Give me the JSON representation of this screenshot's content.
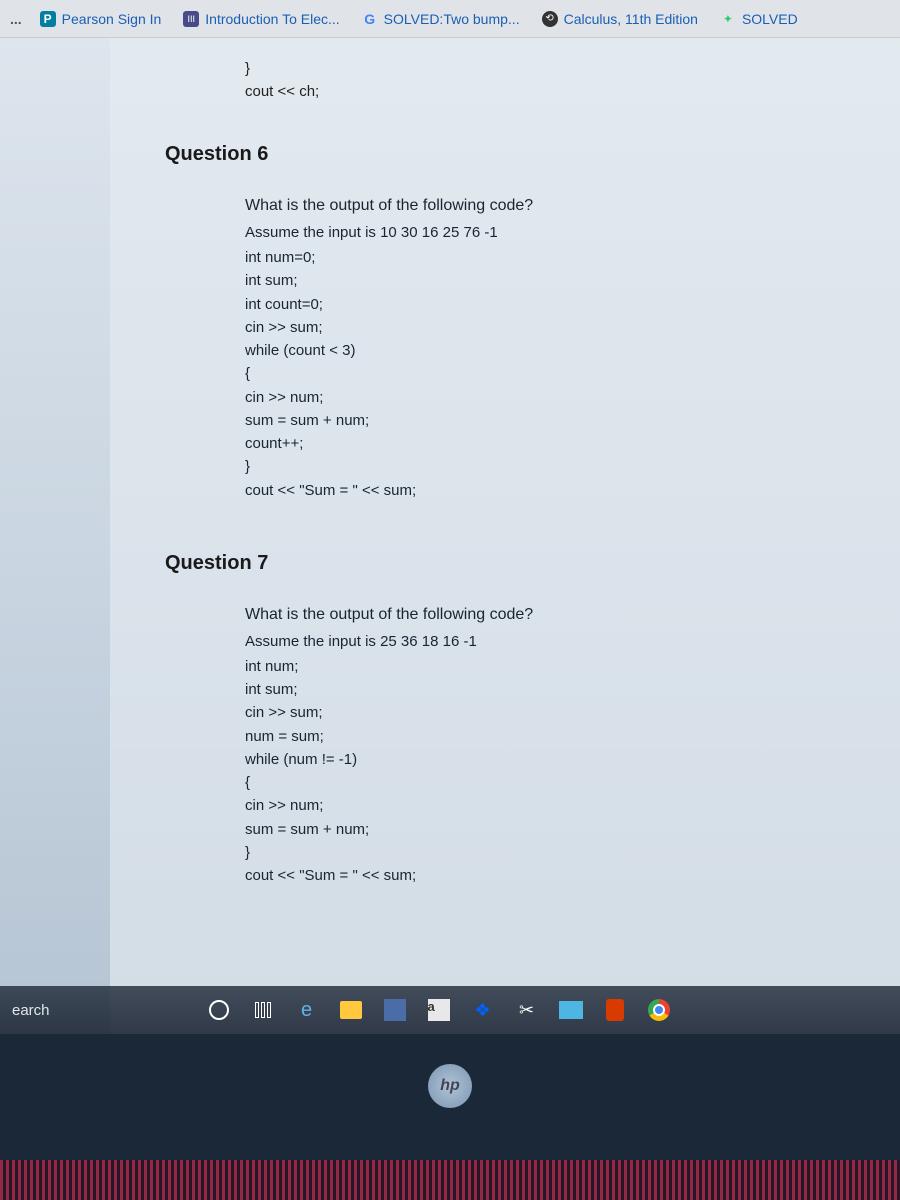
{
  "tabs": {
    "overflow": "...",
    "items": [
      {
        "icon": "P",
        "label": "Pearson Sign In"
      },
      {
        "icon": "III",
        "label": "Introduction To Elec..."
      },
      {
        "icon": "G",
        "label": "SOLVED:Two bump..."
      },
      {
        "icon": "⟲",
        "label": "Calculus, 11th Edition"
      },
      {
        "icon": "✦",
        "label": "SOLVED"
      }
    ]
  },
  "top_snippet": {
    "line1": "}",
    "line2": "cout << ch;"
  },
  "question6": {
    "title": "Question 6",
    "prompt": "What is the output of the following code?",
    "assume": "Assume the input is 10 30 16 25 76 -1",
    "code": [
      "int num=0;",
      "int sum;",
      "int count=0;",
      "cin >> sum;",
      "while (count < 3)",
      "{",
      "cin >> num;",
      "sum = sum + num;",
      "count++;",
      "}",
      "cout << \"Sum = \" << sum;"
    ]
  },
  "question7": {
    "title": "Question 7",
    "prompt": "What is the output of the following code?",
    "assume": "Assume the input is 25 36 18 16 -1",
    "code": [
      "int num;",
      "int sum;",
      "cin >> sum;",
      "num = sum;",
      "while (num != -1)",
      "{",
      "cin >> num;",
      "sum = sum + num;",
      "}",
      "cout << \"Sum = \" << sum;"
    ]
  },
  "taskbar": {
    "search": "earch",
    "a_label": "a"
  },
  "logo": "hp"
}
